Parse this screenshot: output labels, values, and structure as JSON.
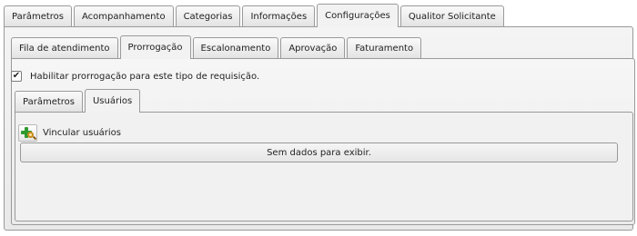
{
  "outer_tabs": [
    {
      "label": "Parâmetros",
      "active": false
    },
    {
      "label": "Acompanhamento",
      "active": false
    },
    {
      "label": "Categorias",
      "active": false
    },
    {
      "label": "Informações",
      "active": false
    },
    {
      "label": "Configurações",
      "active": true
    },
    {
      "label": "Qualitor Solicitante",
      "active": false
    }
  ],
  "config_tabs": [
    {
      "label": "Fila de atendimento",
      "active": false
    },
    {
      "label": "Prorrogação",
      "active": true
    },
    {
      "label": "Escalonamento",
      "active": false
    },
    {
      "label": "Aprovação",
      "active": false
    },
    {
      "label": "Faturamento",
      "active": false
    }
  ],
  "prorrogacao": {
    "enable_checkbox": {
      "label": "Habilitar prorrogação para este tipo de requisição.",
      "checked": true,
      "check_glyph": "✔"
    },
    "sub_tabs": [
      {
        "label": "Parâmetros",
        "active": false
      },
      {
        "label": "Usuários",
        "active": true
      }
    ],
    "usuarios": {
      "link_label": "Vincular usuários",
      "link_icon": "add-search-user-icon",
      "empty_message": "Sem dados para exibir."
    }
  },
  "colors": {
    "border": "#9a9a9a",
    "plus": "#2e9a2e",
    "lens": "#c98a1b"
  }
}
